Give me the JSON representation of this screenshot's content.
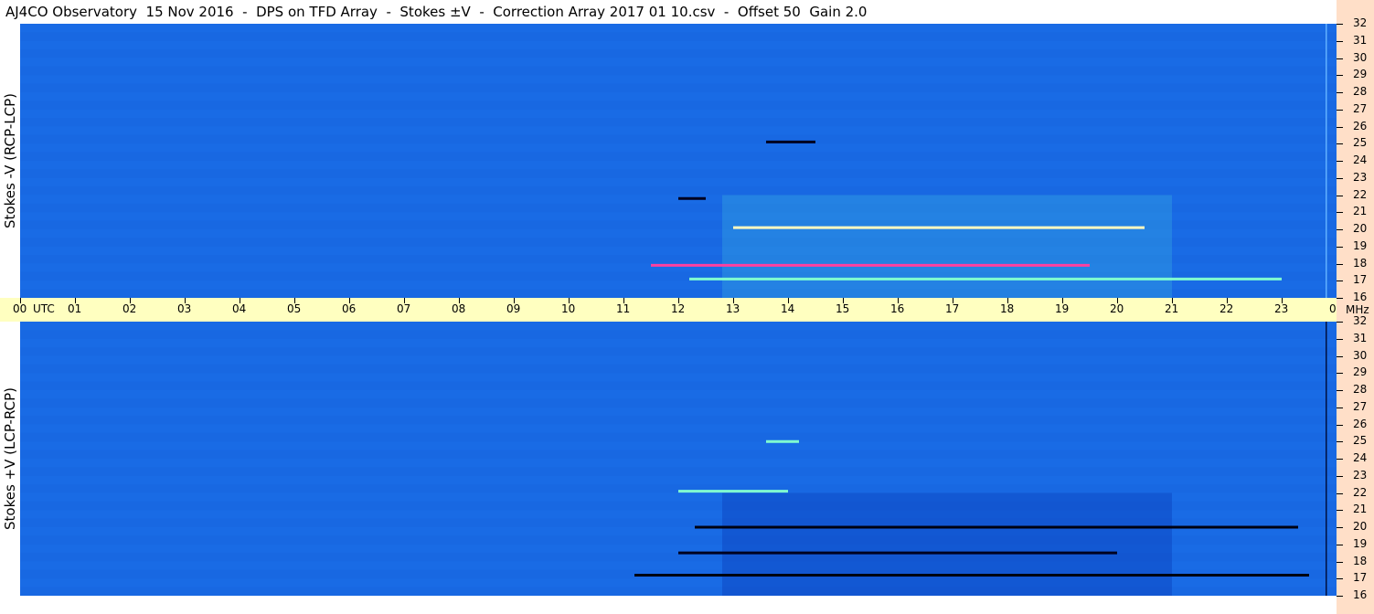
{
  "header": {
    "title": "AJ4CO Observatory  15 Nov 2016  -  DPS on TFD Array  -  Stokes ±V  -  Correction Array 2017 01 10.csv  -  Offset 50  Gain 2.0"
  },
  "panels": {
    "top": {
      "ylabel": "Stokes -V (RCP-LCP)"
    },
    "bottom": {
      "ylabel": "Stokes +V (LCP-RCP)"
    }
  },
  "time_axis": {
    "utc_label": "UTC",
    "mhz_label": "MHz",
    "tick_labels": [
      "00",
      "01",
      "02",
      "03",
      "04",
      "05",
      "06",
      "07",
      "08",
      "09",
      "10",
      "11",
      "12",
      "13",
      "14",
      "15",
      "16",
      "17",
      "18",
      "19",
      "20",
      "21",
      "22",
      "23",
      "00"
    ]
  },
  "freq_axis": {
    "tick_labels": [
      "32",
      "31",
      "30",
      "29",
      "28",
      "27",
      "26",
      "25",
      "24",
      "23",
      "22",
      "21",
      "20",
      "19",
      "18",
      "17",
      "16"
    ]
  },
  "colors": {
    "background_blue": "#1a6ee8",
    "time_axis_bg": "#ffffc0",
    "freq_axis_bg": "#ffdfc8"
  },
  "chart_data": [
    {
      "type": "heatmap",
      "title": "Stokes -V (RCP-LCP)",
      "xlabel": "UTC",
      "ylabel": "MHz",
      "xlim": [
        0,
        24
      ],
      "ylim": [
        16,
        32
      ],
      "features": [
        {
          "t_start": 12.0,
          "t_end": 12.5,
          "freq": 21.8,
          "color": "#000020"
        },
        {
          "t_start": 13.0,
          "t_end": 20.5,
          "freq": 20.1,
          "color": "#fff8c0"
        },
        {
          "t_start": 11.5,
          "t_end": 19.5,
          "freq": 17.9,
          "color": "#ff40a0"
        },
        {
          "t_start": 12.2,
          "t_end": 23.0,
          "freq": 17.1,
          "color": "#80ffd0"
        },
        {
          "t_start": 13.6,
          "t_end": 14.5,
          "freq": 25.1,
          "color": "#000020"
        }
      ]
    },
    {
      "type": "heatmap",
      "title": "Stokes +V (LCP-RCP)",
      "xlabel": "UTC",
      "ylabel": "MHz",
      "xlim": [
        0,
        24
      ],
      "ylim": [
        16,
        32
      ],
      "features": [
        {
          "t_start": 12.3,
          "t_end": 23.3,
          "freq": 20.0,
          "color": "#000010"
        },
        {
          "t_start": 11.2,
          "t_end": 23.5,
          "freq": 17.2,
          "color": "#000010"
        },
        {
          "t_start": 12.0,
          "t_end": 20.0,
          "freq": 18.5,
          "color": "#000020"
        },
        {
          "t_start": 13.6,
          "t_end": 14.2,
          "freq": 25.0,
          "color": "#80ffd0"
        },
        {
          "t_start": 12.0,
          "t_end": 14.0,
          "freq": 22.1,
          "color": "#80ffd0"
        }
      ]
    }
  ]
}
